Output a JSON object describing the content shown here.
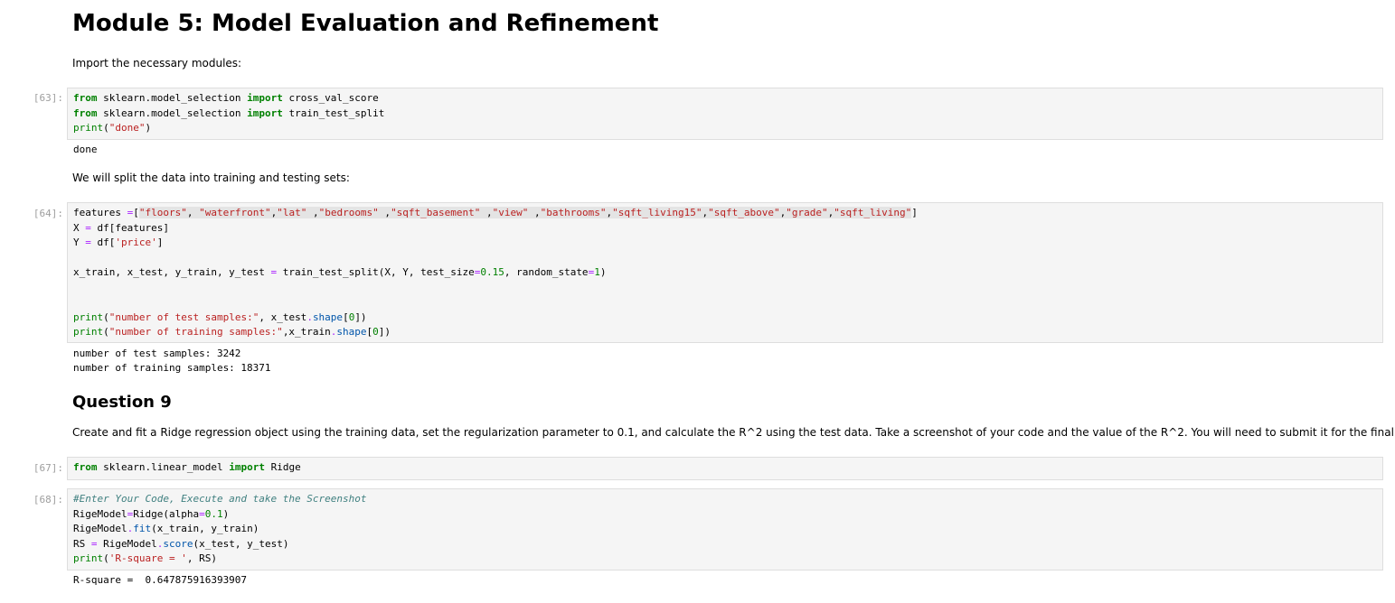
{
  "heading": "Module 5: Model Evaluation and Refinement",
  "intro_text": "Import the necessary modules:",
  "cells": [
    {
      "prompt": "[63]:",
      "lines": [
        "from sklearn.model_selection import cross_val_score",
        "from sklearn.model_selection import train_test_split",
        "print(\"done\")"
      ],
      "output": [
        "done"
      ]
    },
    {
      "prompt": "[64]:",
      "lines": [
        "features =[\"floors\", \"waterfront\",\"lat\" ,\"bedrooms\" ,\"sqft_basement\" ,\"view\" ,\"bathrooms\",\"sqft_living15\",\"sqft_above\",\"grade\",\"sqft_living\"]",
        "X = df[features]",
        "Y = df['price']",
        "",
        "x_train, x_test, y_train, y_test = train_test_split(X, Y, test_size=0.15, random_state=1)",
        "",
        "",
        "print(\"number of test samples:\", x_test.shape[0])",
        "print(\"number of training samples:\",x_train.shape[0])"
      ],
      "output": [
        "number of test samples: 3242",
        "number of training samples: 18371"
      ]
    },
    {
      "prompt": "[67]:",
      "lines": [
        "from sklearn.linear_model import Ridge"
      ],
      "output": []
    },
    {
      "prompt": "[68]:",
      "lines": [
        "#Enter Your Code, Execute and take the Screenshot",
        "RigeModel=Ridge(alpha=0.1)",
        "RigeModel.fit(x_train, y_train)",
        "RS = RigeModel.score(x_test, y_test)",
        "print('R-square = ', RS)"
      ],
      "output": [
        "R-square =  0.647875916393907"
      ]
    }
  ],
  "split_text": "We will split the data into training and testing sets:",
  "question_heading": "Question 9",
  "question_text": "Create and fit a Ridge regression object using the training data, set the regularization parameter to 0.1, and calculate the R^2 using the test data. Take a screenshot of your code and the value of the R^2. You will need to submit it for the final project."
}
